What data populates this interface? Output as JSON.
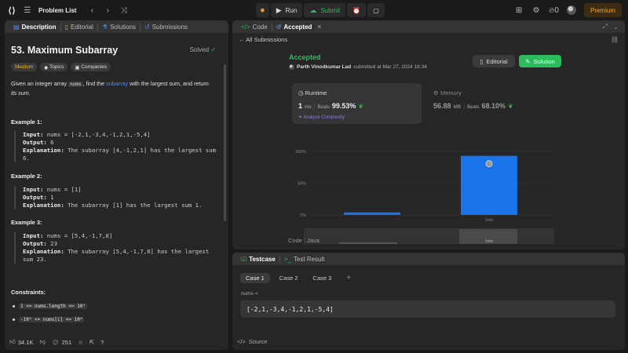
{
  "topbar": {
    "title": "Problem List",
    "run": "Run",
    "submit": "Submit",
    "likes_count": "0",
    "premium": "Premium"
  },
  "left": {
    "tabs": [
      {
        "label": "Description"
      },
      {
        "label": "Editorial"
      },
      {
        "label": "Solutions"
      },
      {
        "label": "Submissions"
      }
    ],
    "title": "53. Maximum Subarray",
    "solved": "Solved",
    "tags": [
      "Medium",
      "Topics",
      "Companies"
    ],
    "desc_1": "Given an integer array ",
    "desc_code": "nums",
    "desc_2": ", find the ",
    "desc_link": "subarray",
    "desc_3": " with the largest sum, and return",
    "desc_4": "its sum.",
    "examples": [
      {
        "title": "Example 1:",
        "input": "nums = [-2,1,-3,4,-1,2,1,-5,4]",
        "output": "6",
        "explanation": "The subarray [4,-1,2,1] has the largest sum",
        "explanation2": "6."
      },
      {
        "title": "Example 2:",
        "input": "nums = [1]",
        "output": "1",
        "explanation": "The subarray [1] has the largest sum 1."
      },
      {
        "title": "Example 3:",
        "input": "nums = [5,4,-1,7,8]",
        "output": "23",
        "explanation": "The subarray [5,4,-1,7,8] has the largest",
        "explanation2": "sum 23."
      }
    ],
    "labels": {
      "input": "Input:",
      "output": "Output:",
      "explanation": "Explanation:"
    },
    "constraints_title": "Constraints:",
    "constraints": [
      "1 <= nums.length <= 10⁵",
      "-10⁴ <= nums[i] <= 10⁴"
    ],
    "footer": {
      "likes": "34.1K",
      "comments": "251"
    }
  },
  "right_top": {
    "tabs": [
      {
        "label": "Code"
      },
      {
        "label": "Accepted"
      }
    ],
    "all_submissions": "All Submissions",
    "status": "Accepted",
    "user": "Parth Vinodkumar Lad",
    "submitted_at": "submitted at Mar 27, 2024 18:34",
    "editorial_btn": "Editorial",
    "solution_btn": "Solution",
    "runtime": {
      "label": "Runtime",
      "value": "1",
      "unit": "ms",
      "beats_label": "Beats",
      "beats": "99.53%"
    },
    "analyze": "Analyze Complexity",
    "memory": {
      "label": "Memory",
      "value": "56.88",
      "unit": "MB",
      "beats_label": "Beats",
      "beats": "68.10%"
    },
    "code_label": "Code",
    "lang": "Java"
  },
  "chart_data": {
    "type": "bar",
    "categories": [
      "",
      "1ms"
    ],
    "values": [
      4,
      93
    ],
    "yticks": [
      "100%",
      "50%",
      "0%"
    ],
    "ylim": [
      0,
      100
    ],
    "xlabel": "1ms",
    "bar_color": "#1a73e8",
    "grid": true
  },
  "right_bot": {
    "tabs": [
      {
        "label": "Testcase"
      },
      {
        "label": "Test Result"
      }
    ],
    "cases": [
      "Case 1",
      "Case 2",
      "Case 3"
    ],
    "nums_label": "nums =",
    "nums_value": "[-2,1,-3,4,-1,2,1,-5,4]",
    "source": "Source"
  }
}
